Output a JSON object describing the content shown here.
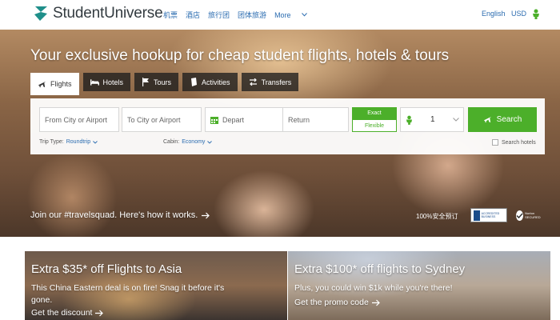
{
  "header": {
    "brand": "StudentUniverse",
    "nav": [
      "机票",
      "酒店",
      "旅行团",
      "团体旅游"
    ],
    "more_label": "More",
    "language": "English",
    "currency": "USD"
  },
  "hero": {
    "headline": "Your exclusive hookup for cheap student flights, hotels & tours",
    "tabs": [
      {
        "label": "Flights",
        "icon": "plane-icon",
        "active": true
      },
      {
        "label": "Hotels",
        "icon": "bed-icon",
        "active": false
      },
      {
        "label": "Tours",
        "icon": "flag-icon",
        "active": false
      },
      {
        "label": "Activities",
        "icon": "activities-icon",
        "active": false
      },
      {
        "label": "Transfers",
        "icon": "transfers-icon",
        "active": false
      }
    ],
    "search": {
      "from_placeholder": "From City or Airport",
      "to_placeholder": "To City or Airport",
      "depart_placeholder": "Depart",
      "return_placeholder": "Return",
      "exact_label": "Exact",
      "flexible_label": "Flexible",
      "passengers": "1",
      "search_label": "Search",
      "trip_type_label": "Trip Type:",
      "trip_type_value": "Roundtrip",
      "cabin_label": "Cabin:",
      "cabin_value": "Economy",
      "search_hotels_label": "Search hotels"
    },
    "squad_text": "Join our #travelsquad. Here's how it works.",
    "secure_text": "100%安全预订",
    "bbb_text": "ACCREDITED BUSINESS",
    "norton_text": "Norton SECURED"
  },
  "promos": [
    {
      "title": "Extra $35* off Flights to Asia",
      "desc": "This China Eastern deal is on fire! Snag it before it's gone.",
      "link": "Get the discount"
    },
    {
      "title": "Extra $100* off flights to Sydney",
      "desc": "Plus, you could win $1k while you're there!",
      "link": "Get the promo code"
    }
  ],
  "colors": {
    "brand_teal": "#1f8f8a",
    "accent_green": "#4caf2a",
    "link_blue": "#2b6cb0"
  }
}
